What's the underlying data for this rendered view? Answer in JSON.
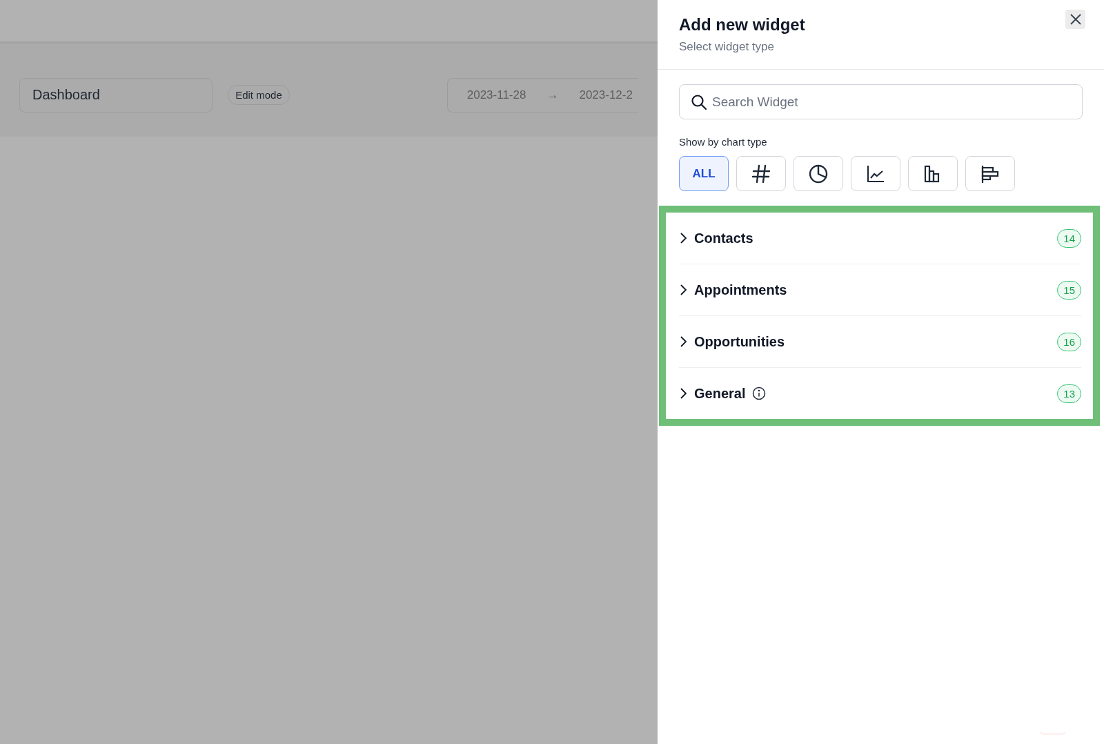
{
  "dashboard": {
    "name": "Dashboard",
    "mode_badge": "Edit mode",
    "date_from": "2023-11-28",
    "date_arrow": "→",
    "date_to": "2023-12-2"
  },
  "panel": {
    "title": "Add new widget",
    "subtitle": "Select widget type",
    "search": {
      "placeholder": "Search Widget"
    },
    "filter_label": "Show by chart type",
    "chart_types": [
      {
        "kind": "text",
        "label": "ALL",
        "selected": true
      },
      {
        "kind": "number",
        "selected": false
      },
      {
        "kind": "pie",
        "selected": false
      },
      {
        "kind": "line",
        "selected": false
      },
      {
        "kind": "column",
        "selected": false
      },
      {
        "kind": "bar",
        "selected": false
      }
    ],
    "categories": [
      {
        "name": "Contacts",
        "count": "14",
        "info": false,
        "expanded": false
      },
      {
        "name": "Appointments",
        "count": "15",
        "info": false,
        "expanded": false
      },
      {
        "name": "Opportunities",
        "count": "16",
        "info": false,
        "expanded": false
      },
      {
        "name": "General",
        "count": "13",
        "info": true,
        "expanded": false
      }
    ]
  }
}
